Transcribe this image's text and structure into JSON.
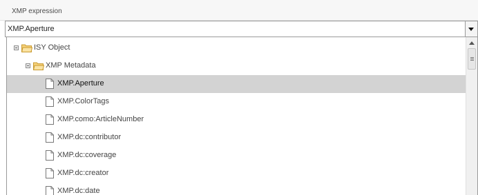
{
  "header": {
    "label": "XMP expression"
  },
  "select": {
    "value": "XMP.Aperture",
    "button_icon": "chevron-down-icon"
  },
  "tree": {
    "root": {
      "label": "ISY Object",
      "icon": "folder-icon",
      "expanded": true
    },
    "group": {
      "label": "XMP Metadata",
      "icon": "folder-icon",
      "expanded": true
    },
    "items": [
      {
        "label": "XMP.Aperture",
        "selected": true
      },
      {
        "label": "XMP.ColorTags",
        "selected": false
      },
      {
        "label": "XMP.como:ArticleNumber",
        "selected": false
      },
      {
        "label": "XMP.dc:contributor",
        "selected": false
      },
      {
        "label": "XMP.dc:coverage",
        "selected": false
      },
      {
        "label": "XMP.dc:creator",
        "selected": false
      },
      {
        "label": "XMP.dc:date",
        "selected": false
      }
    ]
  },
  "colors": {
    "selection": "#d3d3d3",
    "folder_fill": "#f6d27c",
    "folder_stroke": "#c99a2e"
  }
}
